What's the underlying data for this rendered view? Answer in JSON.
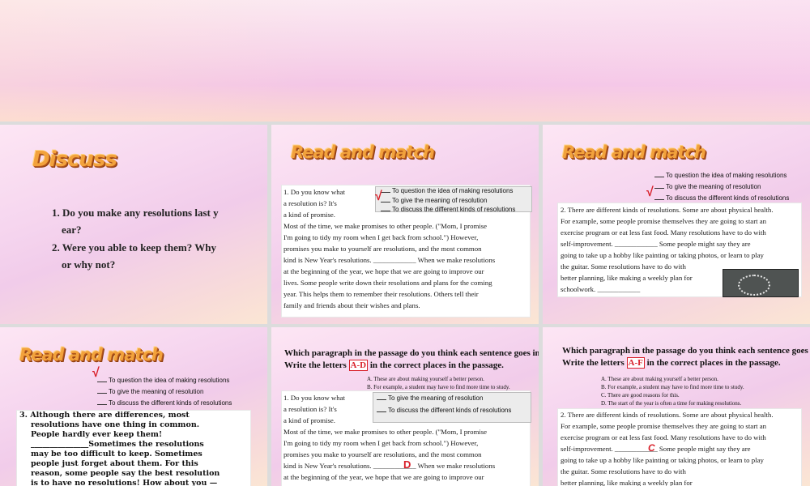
{
  "slide1": {
    "title": "Discuss",
    "q1_line1": "1. Do you make any resolutions last y",
    "q1_line2": "ear?",
    "q2_line1": "2. Were you able to keep them? Why",
    "q2_line2": "or why not?"
  },
  "read_and_match_title": "Read and match",
  "options": {
    "a": "To question the idea of making resolutions",
    "b": "To give the meaning of resolution",
    "c": "To discuss the different kinds of resolutions",
    "b_short": "To give the meaning of resolution",
    "c_short": "To discuss the different kinds of resolutions"
  },
  "check_mark": "√",
  "para1": {
    "l1": "1. Do you know what",
    "l2": "a resolution is? It's",
    "l3": "a kind of promise.",
    "l4": "Most of the time, we make promises to other people. (\"Mom, I promise",
    "l5": "I'm going to tidy my room when I get back from school.\") However,",
    "l6": "promises you make to yourself are resolutions, and the most common",
    "l7": "kind is New Year's resolutions. ____________ When we make resolutions",
    "l8": "at the beginning of the year, we hope that we are going to improve our",
    "l9": "lives. Some people write down their resolutions and plans for the coming",
    "l10": "year. This helps them to remember their resolutions. Others tell their",
    "l11": "family and friends about their wishes and plans."
  },
  "para2": {
    "l1": "2. There are different kinds of resolutions. Some are about physical health.",
    "l2": "For example, some people promise themselves they are going to start an",
    "l3": "exercise program or eat less fast food. Many resolutions have to do with",
    "l4": "self-improvement. ____________ Some people might say they are",
    "l5": "going to take up a hobby like painting or taking photos, or learn to play",
    "l6": "the guitar. Some resolutions have to do with",
    "l7": "better planning, like making a weekly plan for",
    "l8": "schoolwork. ____________"
  },
  "para3": {
    "l1": "3. Although there are differences, most",
    "l2": "resolutions have one thing in common.",
    "l3": "People hardly ever keep them!",
    "l4": "_______________Sometimes the resolutions",
    "l5": "may be too difficult to keep. Sometimes",
    "l6": "people just forget about them. For this",
    "l7": "reason, some people say the best resolution",
    "l8": "is to have no resolutions! How about you —"
  },
  "which_para": {
    "line1": "Which paragraph in the passage do you think each sentence goes in?",
    "line2_pre": "Write the letters ",
    "line2_box5": "A-D",
    "line2_box6": "A-F",
    "line2_post": " in the correct places in the passage.",
    "a": "A. These are about making yourself a better person.",
    "b": "B. For example, a student may have to find more time to study.",
    "c": "C. There are good reasons for this.",
    "d": "D. The start of the year is often a time for making resolutions."
  },
  "answer_d": "D",
  "answer_c": "C"
}
